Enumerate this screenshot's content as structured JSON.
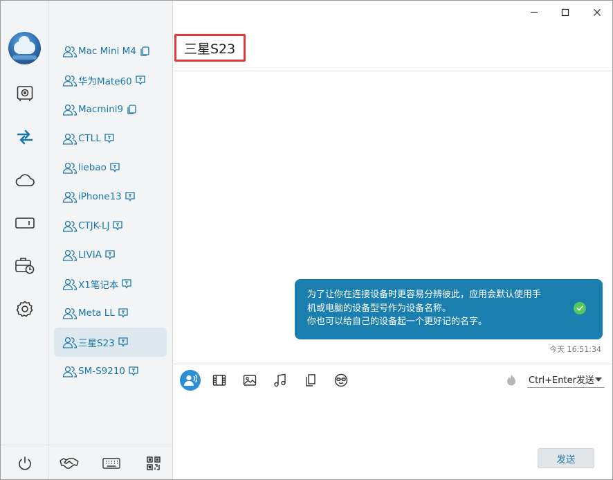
{
  "window": {
    "minimize_icon": "minimize-icon",
    "maximize_icon": "maximize-icon",
    "close_icon": "close-icon"
  },
  "rail": {
    "items": [
      {
        "name": "safe-icon"
      },
      {
        "name": "transfer-icon",
        "active": true
      },
      {
        "name": "cloud-icon"
      },
      {
        "name": "device-icon"
      },
      {
        "name": "toolbox-icon"
      },
      {
        "name": "settings-icon"
      }
    ],
    "power_icon": "power-icon"
  },
  "devices": [
    {
      "label": "Mac Mini M4",
      "type": "copy"
    },
    {
      "label": "华为Mate60",
      "type": "chat"
    },
    {
      "label": "Macmini9",
      "type": "copy"
    },
    {
      "label": "CTLL",
      "type": "chat"
    },
    {
      "label": "liebao",
      "type": "chat"
    },
    {
      "label": "iPhone13",
      "type": "chat"
    },
    {
      "label": "CTJK-LJ",
      "type": "chat"
    },
    {
      "label": "LIVIA",
      "type": "chat"
    },
    {
      "label": "X1笔记本",
      "type": "chat"
    },
    {
      "label": "Meta LL",
      "type": "chat"
    },
    {
      "label": "三星S23",
      "type": "chat",
      "active": true
    },
    {
      "label": "SM-S9210",
      "type": "chat"
    }
  ],
  "list_footer": [
    "handshake-icon",
    "keyboard-icon",
    "qrcode-icon"
  ],
  "header": {
    "title": "三星S23"
  },
  "message": {
    "lines": [
      "为了让你在连接设备时更容易分辨彼此，应用会默认使用手",
      "机或电脑的设备型号作为设备名称。",
      "你也可以给自己的设备起一个更好记的名字。"
    ],
    "timestamp": "今天 16:51:34",
    "status_icon": "check-circle-icon"
  },
  "toolbar": {
    "tools": [
      "contact-icon",
      "video-icon",
      "image-icon",
      "music-icon",
      "file-icon",
      "emoji-icon"
    ],
    "send_mode": "Ctrl+Enter发送",
    "send_label": "发送"
  },
  "colors": {
    "accent": "#1a78aa",
    "bubble": "#1a7fae",
    "highlight_border": "#e03a3a",
    "check": "#55c95b"
  }
}
